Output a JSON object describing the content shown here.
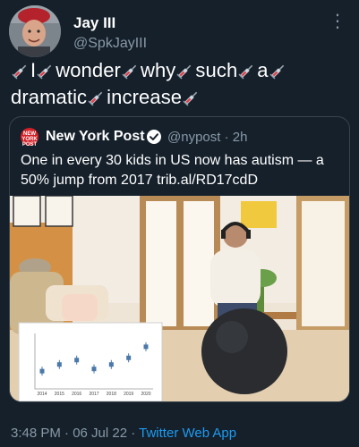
{
  "author": {
    "name": "Jay III",
    "handle": "@SpkJayIII",
    "more_icon": "more-vertical-icon"
  },
  "tweet": {
    "words": [
      "I",
      "wonder",
      "why",
      "such",
      "a",
      "dramatic",
      "increase"
    ],
    "emoji_icon": "syringe-icon"
  },
  "quoted_tweet": {
    "name": "New York Post",
    "handle": "@nypost",
    "time": "· 2h",
    "logo_text_1": "NEW",
    "logo_text_2": "YORK",
    "logo_text_3": "POST",
    "text": "One in every 30 kids in US now has autism — a 50% jump from 2017 trib.al/RD17cdD",
    "image": {
      "description_icon": "photo",
      "inset_chart": {
        "type": "scatter",
        "x": [
          "2014",
          "2015",
          "2016",
          "2017",
          "2018",
          "2019",
          "2020"
        ],
        "values": [
          2.3,
          2.6,
          2.8,
          2.4,
          2.6,
          2.9,
          3.4
        ]
      }
    }
  },
  "footer": {
    "time": "3:48 PM · 06 Jul 22 · ",
    "source": "Twitter Web App"
  },
  "colors": {
    "background": "#15202b",
    "secondary_text": "#8899a6",
    "link": "#1d9bf0",
    "border": "#38444d",
    "np_red": "#d32027"
  }
}
